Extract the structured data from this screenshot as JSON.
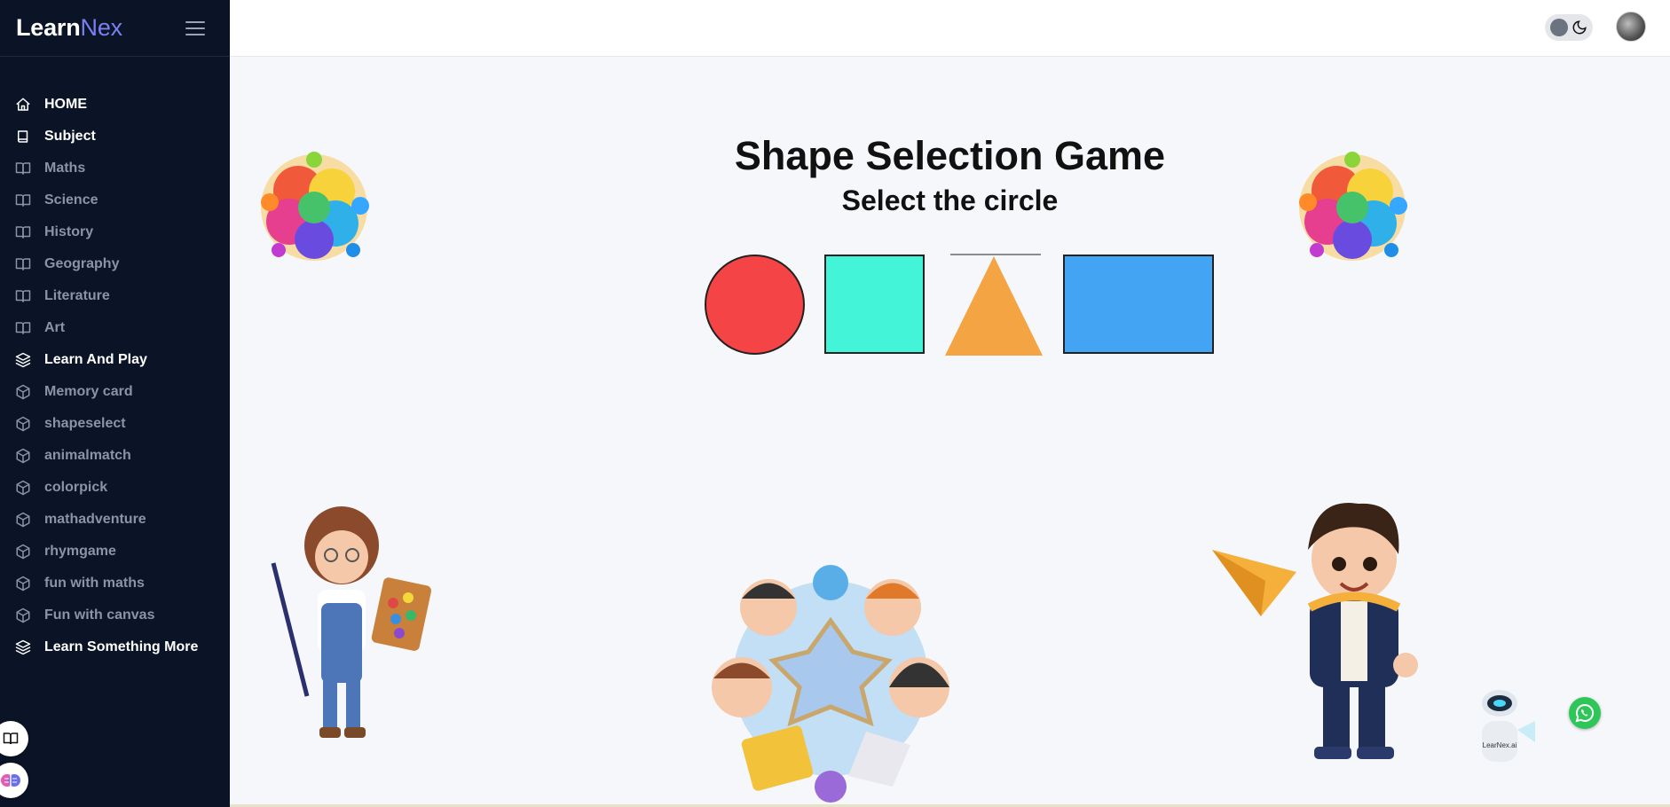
{
  "brand": {
    "name_part1": "Learn",
    "name_part2": "Nex"
  },
  "sidebar": {
    "items": [
      {
        "label": "HOME",
        "icon": "home-icon",
        "style": "primary"
      },
      {
        "label": "Subject",
        "icon": "book-icon",
        "style": "primary"
      },
      {
        "label": "Maths",
        "icon": "open-book-icon",
        "style": "secondary"
      },
      {
        "label": "Science",
        "icon": "open-book-icon",
        "style": "secondary"
      },
      {
        "label": "History",
        "icon": "open-book-icon",
        "style": "secondary"
      },
      {
        "label": "Geography",
        "icon": "open-book-icon",
        "style": "secondary"
      },
      {
        "label": "Literature",
        "icon": "open-book-icon",
        "style": "secondary"
      },
      {
        "label": "Art",
        "icon": "open-book-icon",
        "style": "secondary"
      },
      {
        "label": "Learn And Play",
        "icon": "layers-icon",
        "style": "primary"
      },
      {
        "label": "Memory card",
        "icon": "cube-icon",
        "style": "secondary"
      },
      {
        "label": "shapeselect",
        "icon": "cube-icon",
        "style": "secondary"
      },
      {
        "label": "animalmatch",
        "icon": "cube-icon",
        "style": "secondary"
      },
      {
        "label": "colorpick",
        "icon": "cube-icon",
        "style": "secondary"
      },
      {
        "label": "mathadventure",
        "icon": "cube-icon",
        "style": "secondary"
      },
      {
        "label": "rhymgame",
        "icon": "cube-icon",
        "style": "secondary"
      },
      {
        "label": "fun with maths",
        "icon": "cube-icon",
        "style": "secondary"
      },
      {
        "label": "Fun with canvas",
        "icon": "cube-icon",
        "style": "secondary"
      },
      {
        "label": "Learn Something More",
        "icon": "layers-icon",
        "style": "primary"
      }
    ]
  },
  "game": {
    "title": "Shape Selection Game",
    "prompt": "Select the circle",
    "shapes": [
      {
        "name": "circle",
        "color": "#f44446"
      },
      {
        "name": "square",
        "color": "#43f4d8"
      },
      {
        "name": "triangle",
        "color": "#f4a443"
      },
      {
        "name": "rectangle",
        "color": "#42a4f2"
      }
    ]
  },
  "chatbot": {
    "label": "LearNex.ai"
  },
  "colors": {
    "sidebar_bg": "#0b1326",
    "brand_accent": "#7b7ff0",
    "page_bg": "#f6f7fa"
  }
}
